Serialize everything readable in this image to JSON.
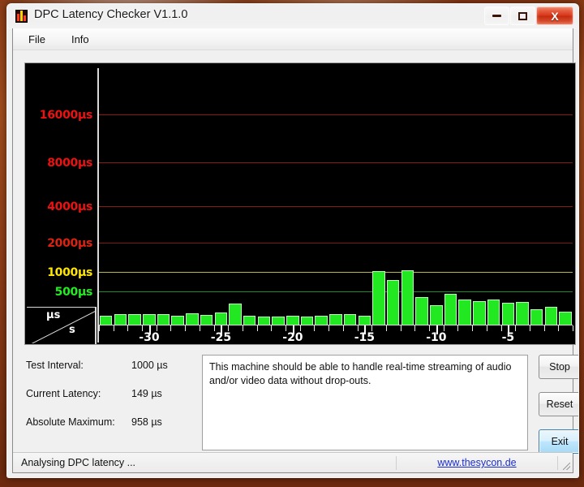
{
  "window": {
    "title": "DPC Latency Checker V1.1.0",
    "app_icon": "bar-chart-icon",
    "controls": {
      "minimize": "minimize-icon",
      "maximize": "maximize-icon",
      "close": "X"
    }
  },
  "menubar": {
    "items": [
      {
        "label": "File"
      },
      {
        "label": "Info"
      }
    ]
  },
  "chart_data": {
    "type": "bar",
    "title": "",
    "xlabel": "s",
    "ylabel": "µs",
    "grid": true,
    "ytick_labels": [
      "16000µs",
      "8000µs",
      "4000µs",
      "2000µs",
      "1000µs",
      "500µs"
    ],
    "ytick_values": [
      16000,
      8000,
      4000,
      2000,
      1000,
      500
    ],
    "ytick_colors": [
      "#ee1111",
      "#ee1111",
      "#ee1111",
      "#dd2211",
      "#ffe600",
      "#22ee22"
    ],
    "gridline_colors": [
      "#8b1a11",
      "#8b1a11",
      "#8b1a11",
      "#7a1a10",
      "#b8b84a",
      "#1f8a2a"
    ],
    "xtick_labels": [
      "-30",
      "-25",
      "-20",
      "-15",
      "-10",
      "-5"
    ],
    "xtick_values": [
      -30,
      -25,
      -20,
      -15,
      -10,
      -5
    ],
    "xlim": [
      -34,
      0
    ],
    "ylim": [
      0,
      20000
    ],
    "bar_color": "#22e822",
    "categories": [
      -33,
      -32,
      -31,
      -30,
      -29,
      -28,
      -27,
      -26,
      -25,
      -24,
      -23,
      -22,
      -21,
      -20,
      -19,
      -18,
      -17,
      -16,
      -15,
      -14,
      -13,
      -12,
      -11,
      -10,
      -9,
      -8,
      -7,
      -6,
      -5,
      -4,
      -3,
      -2,
      -1
    ],
    "values": [
      148,
      168,
      172,
      170,
      170,
      150,
      178,
      155,
      196,
      330,
      150,
      135,
      140,
      148,
      140,
      150,
      175,
      170,
      152,
      1060,
      820,
      1090,
      430,
      305,
      470,
      390,
      360,
      395,
      340,
      355,
      240,
      280,
      210
    ]
  },
  "stats": [
    {
      "label": "Test Interval:",
      "value": "1000 µs"
    },
    {
      "label": "Current Latency:",
      "value": "149 µs"
    },
    {
      "label": "Absolute Maximum:",
      "value": "958 µs"
    }
  ],
  "message": "This machine should be able to handle real-time streaming of audio and/or video data without drop-outs.",
  "buttons": [
    {
      "label": "Stop",
      "focused": false
    },
    {
      "label": "Reset",
      "focused": false
    },
    {
      "label": "Exit",
      "focused": true
    }
  ],
  "statusbar": {
    "text": "Analysing DPC latency ...",
    "link": "www.thesycon.de",
    "grip": "resize-grip-icon"
  }
}
